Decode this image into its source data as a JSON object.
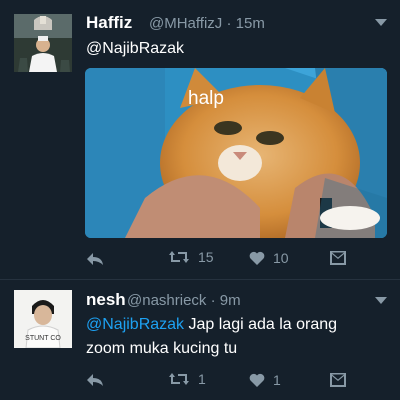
{
  "tweet1": {
    "name": "Haffiz",
    "handle": "@MHaffizJ",
    "time": "15m",
    "mention": "@NajibRazak",
    "image_caption": "halp",
    "retweets": "15",
    "likes": "10"
  },
  "tweet2": {
    "name": "nesh",
    "handle": "@nashrieck",
    "time": "9m",
    "mention": "@NajibRazak",
    "text_line1": " Jap lagi ada la orang",
    "text_line2": "zoom muka kucing tu",
    "retweets": "1",
    "likes": "1"
  },
  "icons": [
    "reply-icon",
    "retweet-icon",
    "like-icon",
    "direct-message-icon",
    "caret-down-icon"
  ],
  "colors": {
    "background": "#15202b",
    "accent": "#1da1f2",
    "muted": "#8899a6"
  }
}
